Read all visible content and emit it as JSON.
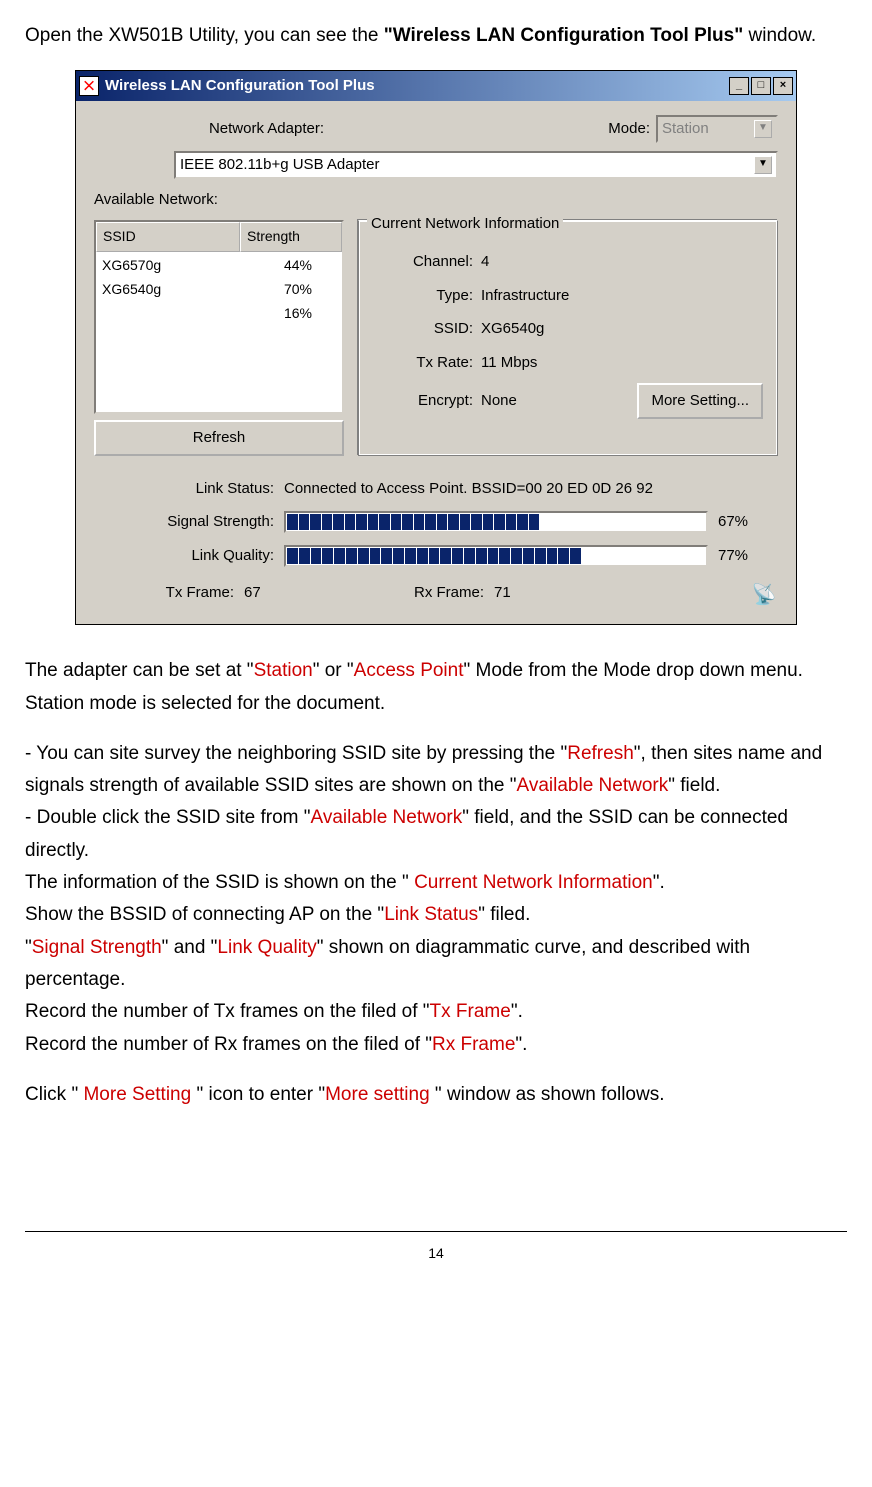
{
  "intro_pre": "Open the XW501B Utility, you can see the ",
  "intro_bold": "\"Wireless LAN Configuration Tool Plus\"",
  "intro_post": " window.",
  "window": {
    "title": "Wireless LAN Configuration Tool Plus",
    "network_adapter_label": "Network Adapter:",
    "mode_label": "Mode:",
    "mode_value": "Station",
    "adapter_value": "IEEE 802.11b+g USB Adapter",
    "available_label": "Available Network:",
    "col_ssid": "SSID",
    "col_strength": "Strength",
    "networks": [
      {
        "ssid": "XG6570g",
        "strength": "44%"
      },
      {
        "ssid": "XG6540g",
        "strength": "70%"
      },
      {
        "ssid": "",
        "strength": "16%"
      }
    ],
    "refresh": "Refresh",
    "current_info_label": "Current Network Information",
    "channel_label": "Channel:",
    "channel_value": "4",
    "type_label": "Type:",
    "type_value": "Infrastructure",
    "ssid_label": "SSID:",
    "ssid_value": "XG6540g",
    "txrate_label": "Tx Rate:",
    "txrate_value": "11 Mbps",
    "encrypt_label": "Encrypt:",
    "encrypt_value": "None",
    "more_setting": "More Setting...",
    "link_status_label": "Link Status:",
    "link_status_value": "Connected to Access Point. BSSID=00 20 ED 0D 26 92",
    "signal_strength_label": "Signal Strength:",
    "signal_strength_pct": "67%",
    "link_quality_label": "Link Quality:",
    "link_quality_pct": "77%",
    "txframe_label": "Tx Frame:",
    "txframe_value": "67",
    "rxframe_label": "Rx Frame:",
    "rxframe_value": "71"
  },
  "body": {
    "p1a": "The adapter can be set at \"",
    "p1_station": "Station",
    "p1b": "\" or \"",
    "p1_ap": "Access Point",
    "p1c": "\" Mode from the Mode drop down menu. Station mode is selected for the document.",
    "bul1a": "  -  You can site survey the neighboring SSID site by pressing the \"",
    "bul1_refresh": "Refresh",
    "bul1b": "\", then sites name and signals strength of available SSID sites are shown on the \"",
    "bul1_avail": "Available Network",
    "bul1c": "\" field.",
    "bul2a": "-  Double click the SSID site from \"",
    "bul2_avail": "Available Network",
    "bul2b": "\" field, and the SSID can be connected directly.",
    "p3a": "The information of the SSID is shown on the \" ",
    "p3_cni": "Current Network Information",
    "p3b": "\".",
    "p4a": "Show the BSSID of connecting AP on the \"",
    "p4_ls": "Link Status",
    "p4b": "\" filed.",
    "p5a": "\"",
    "p5_ss": "Signal Strength",
    "p5b": "\" and \"",
    "p5_lq": "Link Quality",
    "p5c": "\" shown on diagrammatic curve, and described with percentage.",
    "p6a": "Record the number of Tx frames on the filed of \"",
    "p6_tx": "Tx Frame",
    "p6b": "\".",
    "p7a": "Record the number of Rx frames on the filed of \"",
    "p7_rx": "Rx Frame",
    "p7b": "\".",
    "p8a": "Click \" ",
    "p8_ms1": "More Setting",
    "p8b": " \" icon to enter \"",
    "p8_ms2": "More setting",
    "p8c": " \" window as shown follows."
  },
  "page_number": "14"
}
